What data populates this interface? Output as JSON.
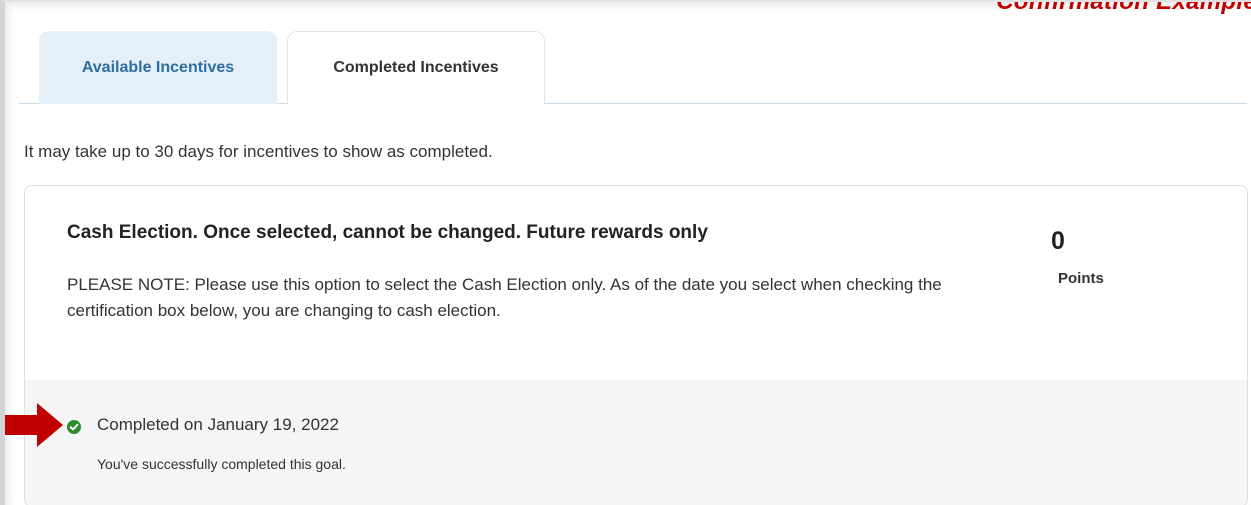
{
  "watermark": {
    "text": "Confirmation Example",
    "color": "#c00000"
  },
  "tabs": [
    {
      "label": "Available Incentives",
      "active": true
    },
    {
      "label": "Completed Incentives",
      "active": false
    }
  ],
  "notice": "It may take up to 30 days for incentives to show as completed.",
  "incentive": {
    "title": "Cash Election. Once selected, cannot be changed. Future rewards only",
    "description": "PLEASE NOTE: Please use this option to select the Cash Election only. As of the date you select when checking the certification box below, you are changing to cash election.",
    "points_value": "0",
    "points_label": "Points",
    "status": {
      "icon": "check-circle-icon",
      "text": "Completed on January 19, 2022",
      "subtext": "You've successfully completed this goal."
    }
  },
  "colors": {
    "active_tab_bg": "#e4eff8",
    "active_tab_text": "#2e6da4",
    "success_green": "#2e8b2e",
    "arrow_red": "#c00000"
  },
  "annotation": {
    "icon": "red-arrow-icon"
  }
}
